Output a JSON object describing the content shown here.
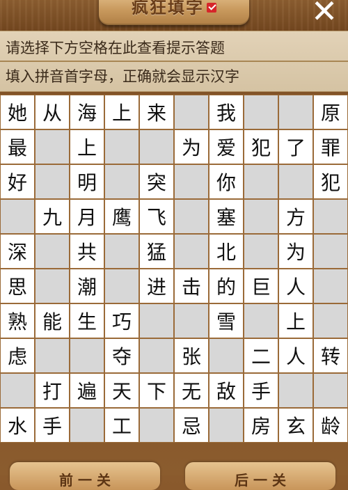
{
  "header": {
    "title": "疯狂填字",
    "close_glyph": "✕"
  },
  "hints": {
    "line1": "请选择下方空格在此查看提示答题",
    "line2": "填入拼音首字母，正确就会显示汉字"
  },
  "grid": [
    [
      "她",
      "从",
      "海",
      "上",
      "来",
      "",
      "我",
      "",
      "",
      "原"
    ],
    [
      "最",
      "",
      "上",
      "",
      "",
      "为",
      "爱",
      "犯",
      "了",
      "罪"
    ],
    [
      "好",
      "",
      "明",
      "",
      "突",
      "",
      "你",
      "",
      "",
      "犯"
    ],
    [
      "",
      "九",
      "月",
      "鹰",
      "飞",
      "",
      "塞",
      "",
      "方",
      ""
    ],
    [
      "深",
      "",
      "共",
      "",
      "猛",
      "",
      "北",
      "",
      "为",
      ""
    ],
    [
      "思",
      "",
      "潮",
      "",
      "进",
      "击",
      "的",
      "巨",
      "人",
      ""
    ],
    [
      "熟",
      "能",
      "生",
      "巧",
      "",
      "",
      "雪",
      "",
      "上",
      ""
    ],
    [
      "虑",
      "",
      "",
      "夺",
      "",
      "张",
      "",
      "二",
      "人",
      "转"
    ],
    [
      "",
      "打",
      "遍",
      "天",
      "下",
      "无",
      "敌",
      "手",
      "",
      ""
    ],
    [
      "水",
      "手",
      "",
      "工",
      "",
      "忌",
      "",
      "房",
      "玄",
      "龄"
    ]
  ],
  "buttons": {
    "prev_label": "前 一 关",
    "next_label": "后 一 关"
  },
  "colors": {
    "empty_cell": "#d7d7d7",
    "filled_cell": "#ffffff",
    "grid_line": "#9a6a38"
  }
}
